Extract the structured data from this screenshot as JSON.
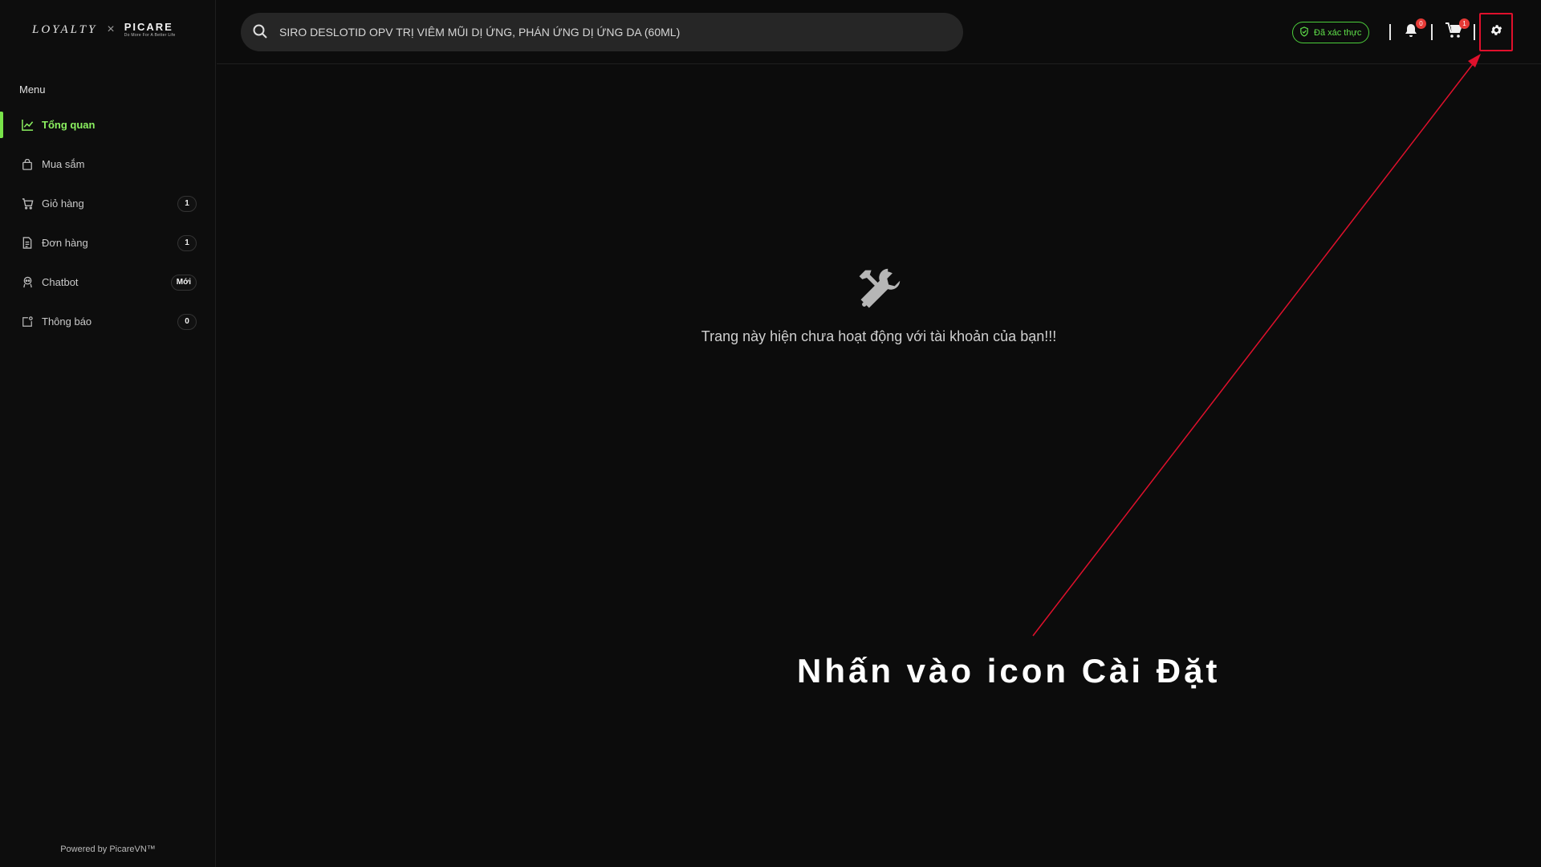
{
  "brand": {
    "loyalty": "LOYALTY",
    "separator": "×",
    "picare_name": "PICARE",
    "picare_tagline": "Do More For A Better Life"
  },
  "sidebar": {
    "heading": "Menu",
    "items": [
      {
        "label": "Tổng quan",
        "icon": "chart-line-icon",
        "badge": "",
        "active": true
      },
      {
        "label": "Mua sắm",
        "icon": "shopping-bag-icon",
        "badge": ""
      },
      {
        "label": "Giỏ hàng",
        "icon": "cart-icon",
        "badge": "1"
      },
      {
        "label": "Đơn hàng",
        "icon": "document-icon",
        "badge": "1"
      },
      {
        "label": "Chatbot",
        "icon": "robot-icon",
        "badge": "Mới"
      },
      {
        "label": "Thông báo",
        "icon": "notification-icon",
        "badge": "0"
      }
    ],
    "powered_by": "Powered by PicareVN™"
  },
  "header": {
    "search_value": "SIRO DESLOTID OPV TRỊ VIÊM MŨI DỊ ỨNG, PHÁN ỨNG DỊ ỨNG DA (60ML)",
    "verified_label": "Đã xác thực",
    "notification_count": "0",
    "cart_count": "1",
    "settings_icon": "gear-icon"
  },
  "main": {
    "empty_icon": "tools-icon",
    "empty_message": "Trang này hiện chưa hoạt động với tài khoản của bạn!!!"
  },
  "annotation": {
    "text": "Nhấn vào icon Cài Đặt",
    "color": "#e0102c"
  },
  "colors": {
    "accent_green": "#79e34a",
    "background": "#0c0c0c",
    "badge_red": "#e53935"
  }
}
